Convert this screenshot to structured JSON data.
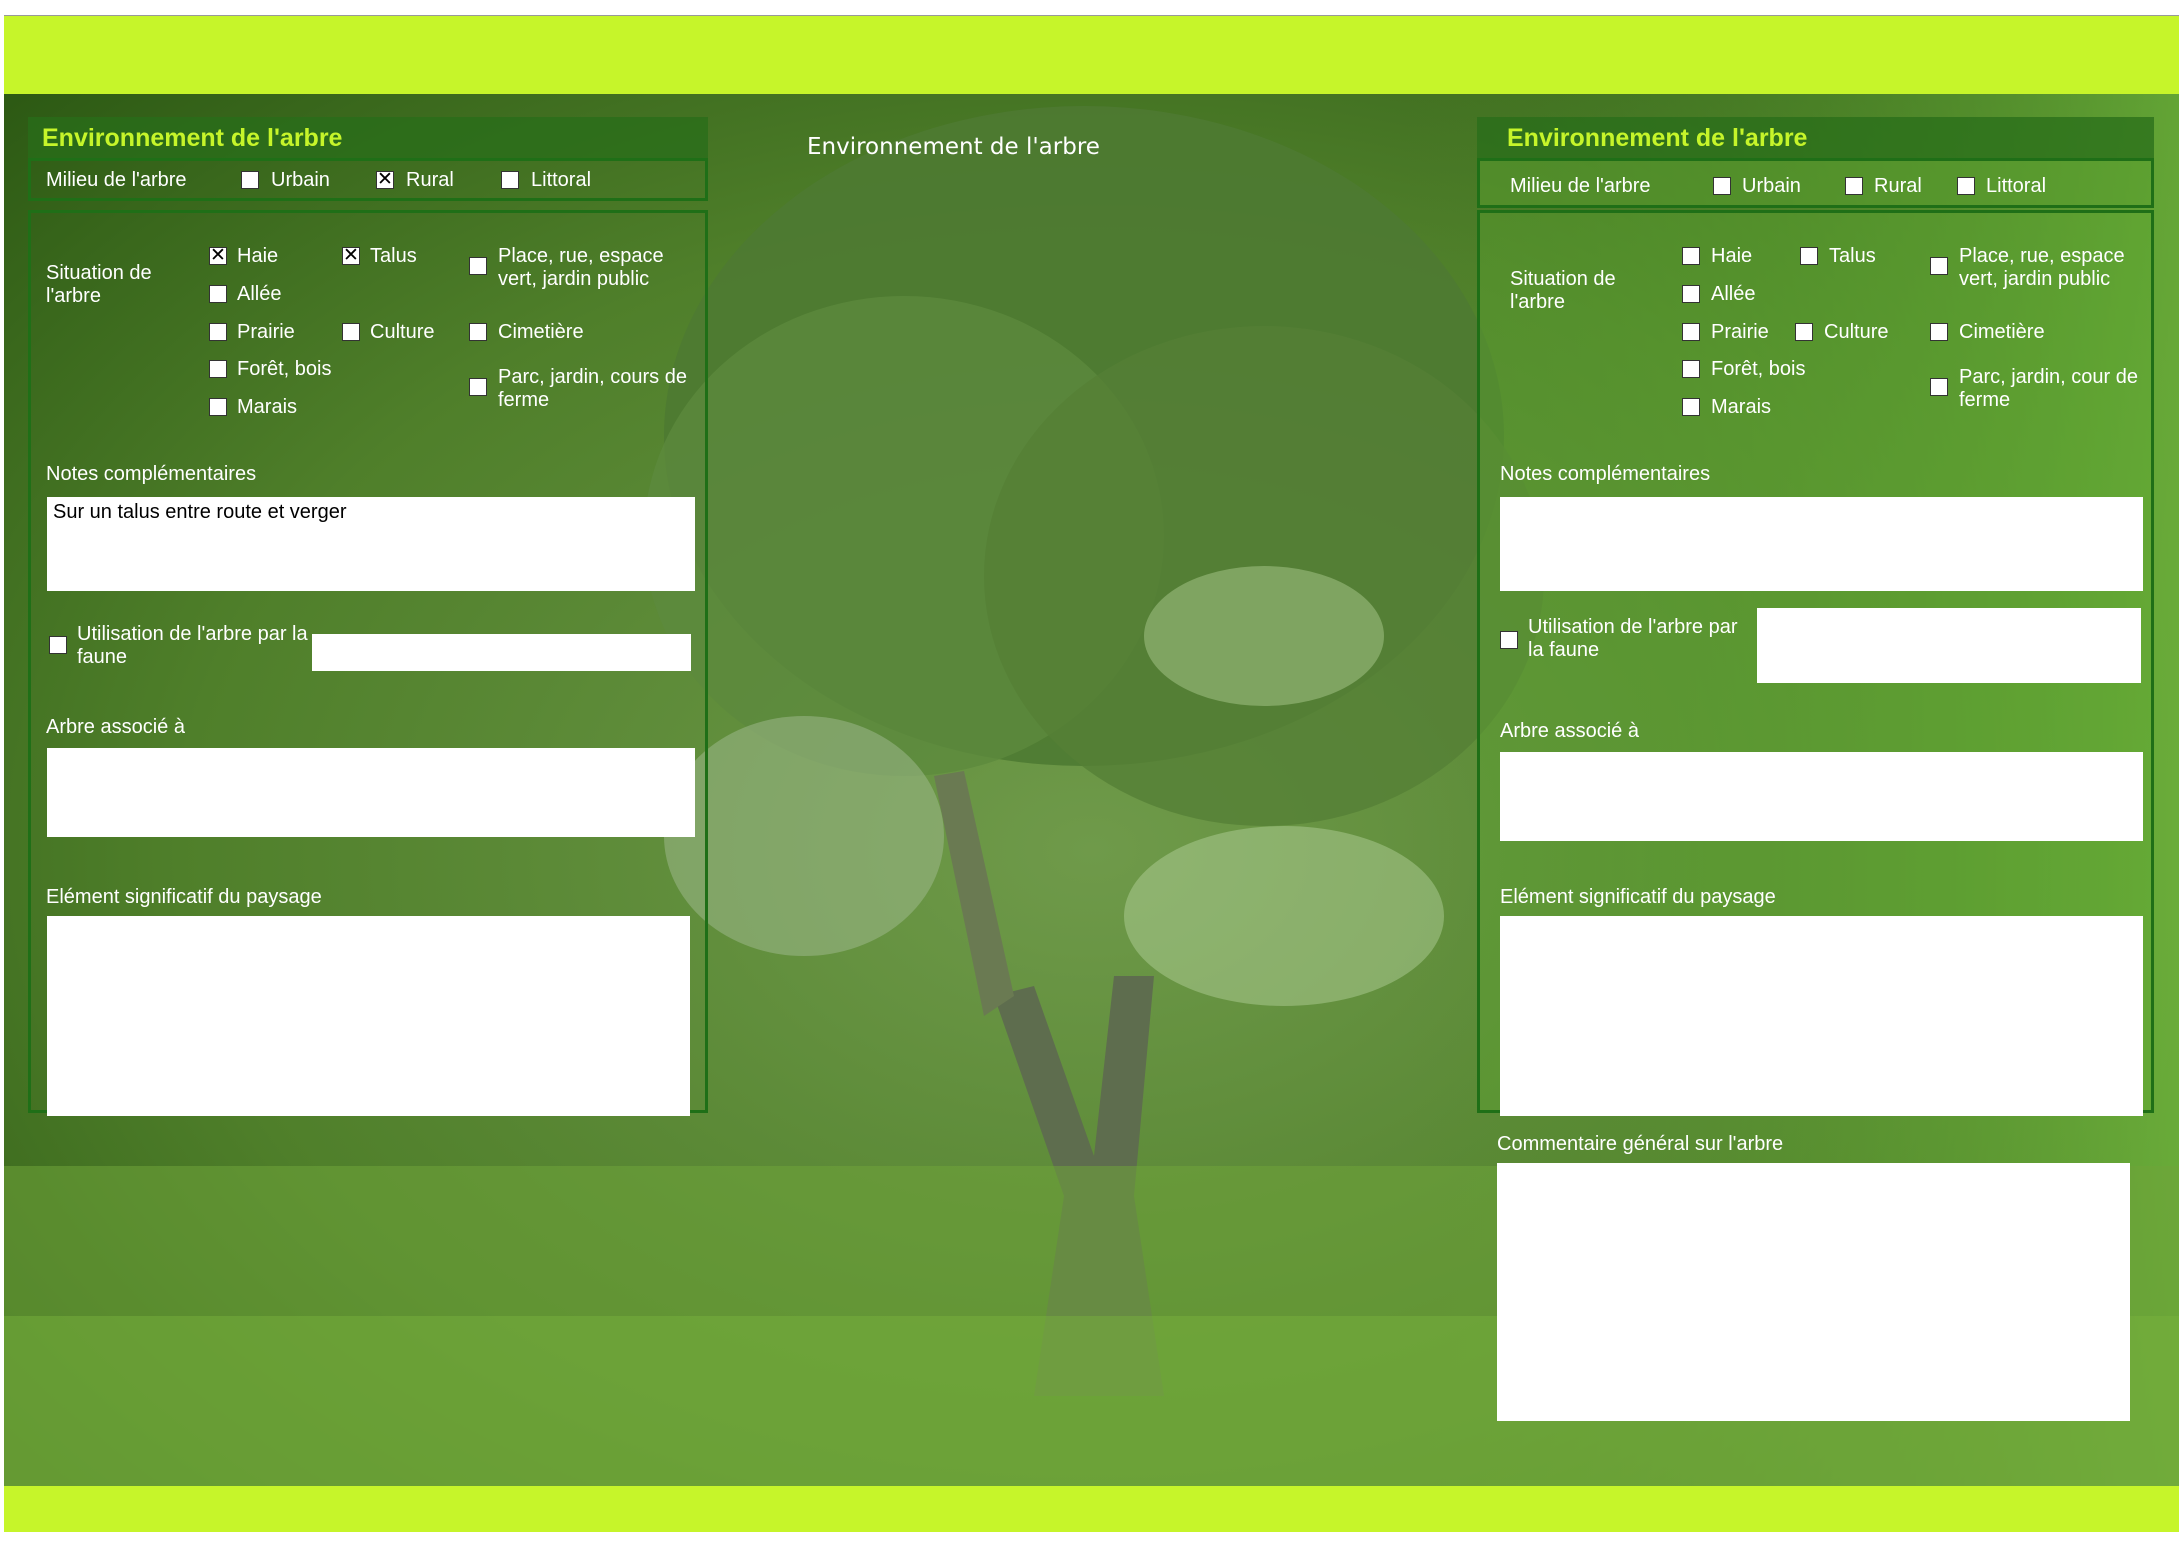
{
  "center_title": "Environnement de l'arbre",
  "left": {
    "title": "Environnement de l'arbre",
    "milieu_label": "Milieu de l'arbre",
    "milieu": [
      {
        "label": "Urbain",
        "checked": false
      },
      {
        "label": "Rural",
        "checked": true
      },
      {
        "label": "Littoral",
        "checked": false
      }
    ],
    "situation_label": "Situation de l'arbre",
    "situation": {
      "haie": {
        "label": "Haie",
        "checked": true
      },
      "talus": {
        "label": "Talus",
        "checked": true
      },
      "place": {
        "label": "Place, rue, espace vert, jardin public",
        "checked": false
      },
      "allee": {
        "label": "Allée",
        "checked": false
      },
      "prairie": {
        "label": "Prairie",
        "checked": false
      },
      "culture": {
        "label": "Culture",
        "checked": false
      },
      "cimetiere": {
        "label": "Cimetière",
        "checked": false
      },
      "foret": {
        "label": "Forêt, bois",
        "checked": false
      },
      "parc": {
        "label": "Parc, jardin, cours de ferme",
        "checked": false
      },
      "marais": {
        "label": "Marais",
        "checked": false
      }
    },
    "notes_label": "Notes complémentaires",
    "notes_value": "Sur un talus entre route et verger",
    "faune_label": "Utilisation de l'arbre par la faune",
    "faune_checked": false,
    "faune_value": "",
    "associe_label": "Arbre associé à",
    "associe_value": "",
    "element_label": "Elément significatif du paysage",
    "element_value": ""
  },
  "right": {
    "title": "Environnement de l'arbre",
    "milieu_label": "Milieu de l'arbre",
    "milieu": [
      {
        "label": "Urbain",
        "checked": false
      },
      {
        "label": "Rural",
        "checked": false
      },
      {
        "label": "Littoral",
        "checked": false
      }
    ],
    "situation_label": "Situation de l'arbre",
    "situation": {
      "haie": {
        "label": "Haie",
        "checked": false
      },
      "talus": {
        "label": "Talus",
        "checked": false
      },
      "place": {
        "label": "Place, rue, espace vert, jardin public",
        "checked": false
      },
      "allee": {
        "label": "Allée",
        "checked": false
      },
      "prairie": {
        "label": "Prairie",
        "checked": false
      },
      "culture": {
        "label": "Culture",
        "checked": false
      },
      "cimetiere": {
        "label": "Cimetière",
        "checked": false
      },
      "foret": {
        "label": "Forêt, bois",
        "checked": false
      },
      "parc": {
        "label": "Parc, jardin, cour de ferme",
        "checked": false
      },
      "marais": {
        "label": "Marais",
        "checked": false
      }
    },
    "notes_label": "Notes complémentaires",
    "notes_value": "",
    "faune_label": "Utilisation de l'arbre par la faune",
    "faune_checked": false,
    "faune_value": "",
    "associe_label": "Arbre associé à",
    "associe_value": "",
    "element_label": "Elément significatif du paysage",
    "element_value": "",
    "commentaire_label": "Commentaire général sur l'arbre",
    "commentaire_value": ""
  },
  "colors": {
    "accent": "#c6f52a",
    "panel_border": "#1f6f17",
    "background": "#3f6e1c"
  }
}
